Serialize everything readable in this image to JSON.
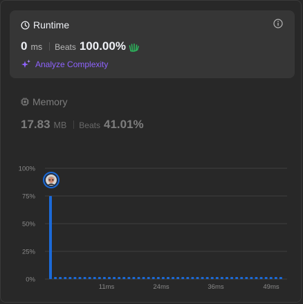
{
  "runtime": {
    "title": "Runtime",
    "value": "0",
    "unit": "ms",
    "beats_label": "Beats",
    "beats_value": "100.00%",
    "analyze_label": "Analyze Complexity"
  },
  "memory": {
    "title": "Memory",
    "value": "17.83",
    "unit": "MB",
    "beats_label": "Beats",
    "beats_value": "41.01%"
  },
  "colors": {
    "bar": "#1b6ad8",
    "analyze": "#8f63ff",
    "clap": "#2db55d"
  },
  "icons": [
    "clock-icon",
    "info-icon",
    "clap-icon",
    "sparkle-icon",
    "chip-icon",
    "user-avatar"
  ],
  "chart_data": {
    "type": "bar",
    "ylim": [
      0,
      100
    ],
    "y_tick_labels": [
      "100%",
      "75%",
      "50%",
      "25%",
      "0%"
    ],
    "x_tick_labels": [
      "11ms",
      "24ms",
      "36ms",
      "49ms"
    ],
    "values": [
      75,
      1,
      1,
      1,
      1,
      1,
      1,
      1,
      1,
      1,
      1,
      1,
      1,
      1,
      1,
      1,
      1,
      1,
      1,
      1,
      1,
      1,
      1,
      1,
      1,
      1,
      1,
      1,
      1,
      1,
      1,
      1,
      1,
      1,
      1,
      1,
      1,
      1,
      1,
      1,
      1,
      1,
      1,
      1,
      1,
      1,
      1,
      1
    ],
    "highlight_index": 0
  }
}
